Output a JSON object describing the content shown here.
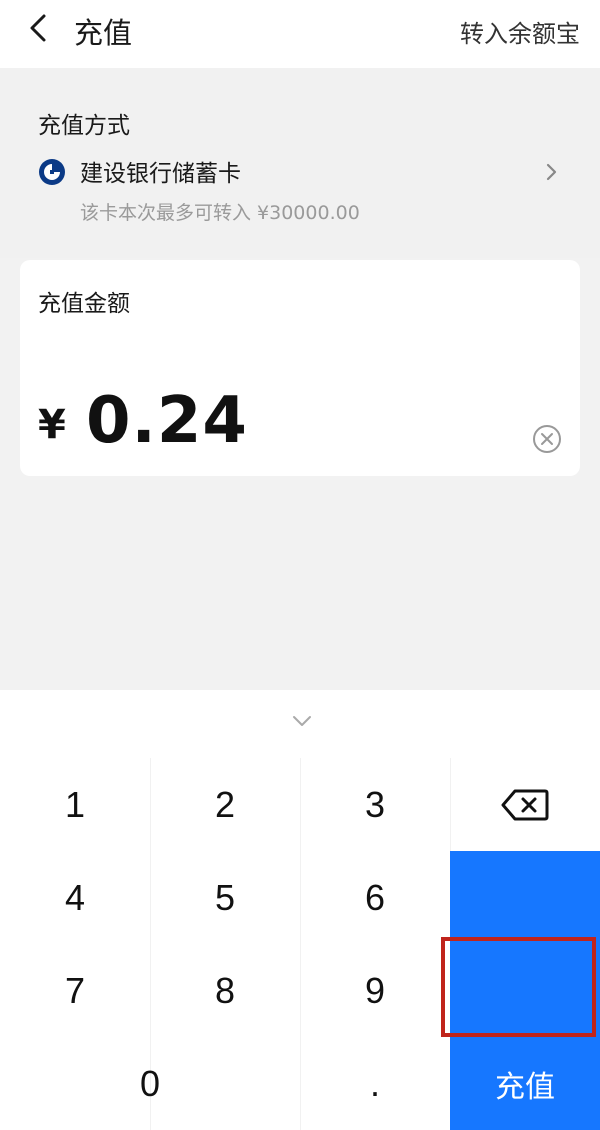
{
  "header": {
    "title": "充值",
    "right_action": "转入余额宝"
  },
  "payment": {
    "label": "充值方式",
    "bank_name": "建设银行储蓄卡",
    "limit_text": "该卡本次最多可转入 ¥30000.00"
  },
  "amount": {
    "label": "充值金额",
    "currency": "¥",
    "value": "0.24"
  },
  "keypad": {
    "keys": [
      "1",
      "2",
      "3",
      "4",
      "5",
      "6",
      "7",
      "8",
      "9",
      "0",
      "."
    ],
    "submit_label": "充值"
  },
  "colors": {
    "accent": "#1677ff",
    "highlight": "#c0241b",
    "background": "#f2f2f2"
  },
  "icons": {
    "back": "back-icon",
    "bank": "ccb-bank-icon",
    "chevron": "chevron-right-icon",
    "clear": "clear-icon",
    "collapse": "collapse-keyboard-icon",
    "delete": "backspace-icon"
  }
}
